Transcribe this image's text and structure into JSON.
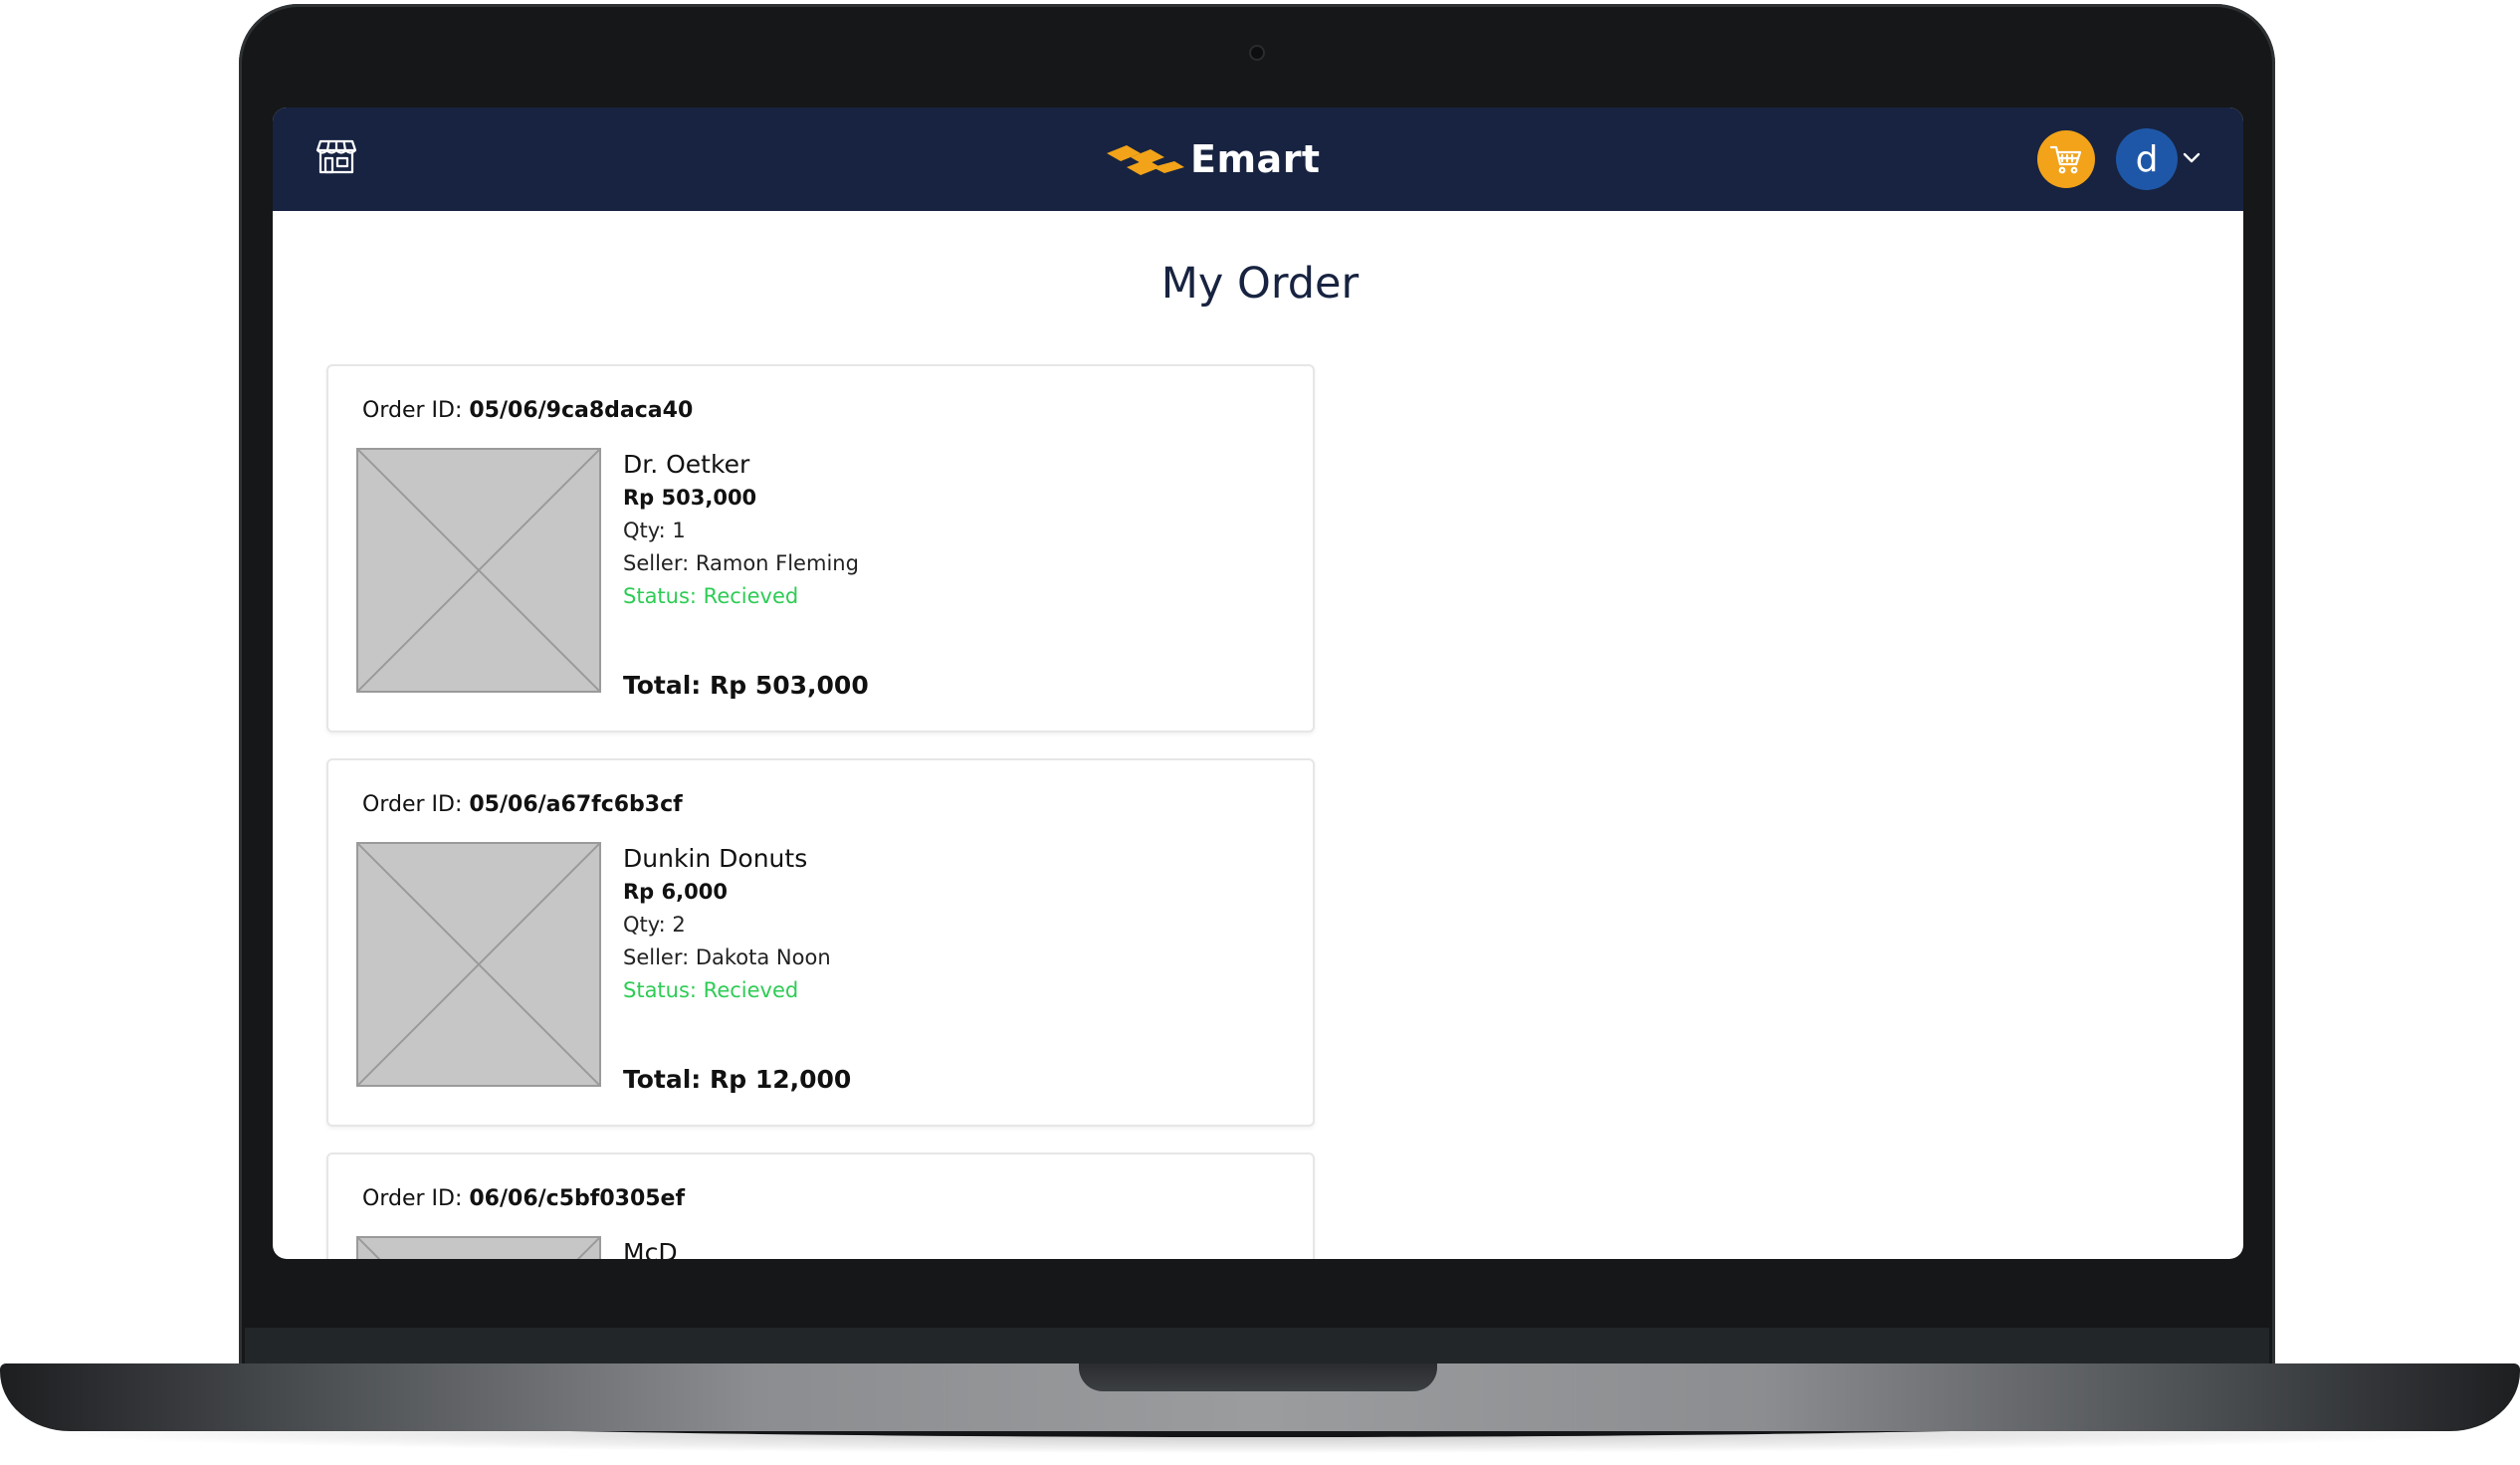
{
  "app": {
    "brand": "Emart",
    "page_title": "My Order",
    "user_initial": "d",
    "colors": {
      "navbar": "#172340",
      "cart": "#f2a319",
      "avatar": "#1f57a8",
      "status_received": "#2ecc55",
      "logo_orange": "#f2a319"
    }
  },
  "navbar": {
    "store_icon": "store-icon",
    "cart_icon": "shopping-cart-icon",
    "caret_icon": "chevron-down-icon"
  },
  "labels": {
    "order_id": "Order ID: ",
    "qty": "Qty: ",
    "seller": "Seller: ",
    "status": "Status: ",
    "total": "Total: "
  },
  "orders": [
    {
      "id": "05/06/9ca8daca40",
      "product": "Dr. Oetker",
      "price": "Rp 503,000",
      "qty": "1",
      "seller": "Ramon Fleming",
      "status": "Recieved",
      "total": "Rp 503,000"
    },
    {
      "id": "05/06/a67fc6b3cf",
      "product": "Dunkin Donuts",
      "price": "Rp 6,000",
      "qty": "2",
      "seller": "Dakota Noon",
      "status": "Recieved",
      "total": "Rp 12,000"
    },
    {
      "id": "06/06/c5bf0305ef",
      "product": "McD"
    }
  ]
}
